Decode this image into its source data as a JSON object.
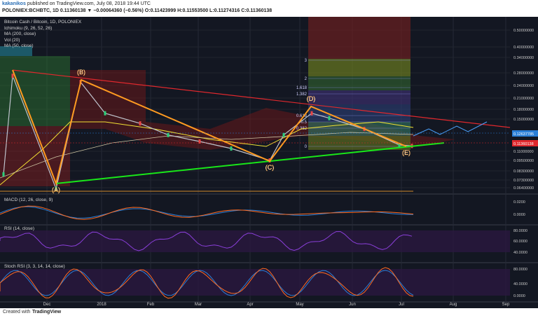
{
  "header": {
    "author": "kakanikos",
    "published": "published on TradingView.com, July 08, 2018 19:44 UTC",
    "symbol_line": "POLONIEX:BCHBTC, 1D 0.11360138 ▼ −0.00064360 (−0.56%) O:0.11423999 H:0.11553500 L:0.11274316 C:0.11360138"
  },
  "legend": {
    "title": "Bitcoin Cash / Bitcoin, 1D, POLONIEX",
    "items": [
      "Ichimoku (9, 26, 52, 26)",
      "MA (200, close)",
      "Vol (20)",
      "MA (50, close)"
    ]
  },
  "footer": {
    "created_with": "Created with",
    "logo": "TradingView"
  },
  "colors": {
    "background": "#131722",
    "pattern": "#ff9b21",
    "support": "#19e619",
    "resistance": "#e0282d",
    "ma_yellow": "#f2e033",
    "macd": "#2a7fd8",
    "signal": "#ff6a1f",
    "rsi": "#8a3fd9"
  },
  "chart_data": [
    {
      "type": "line",
      "title": "Bitcoin Cash / Bitcoin, 1D, POLONIEX",
      "xlabel": "",
      "ylabel": "",
      "x_ticks": [
        "Dec",
        "2018",
        "Feb",
        "Mar",
        "Apr",
        "May",
        "Jun",
        "Jul",
        "Aug",
        "Sep"
      ],
      "y_ticks": [
        "0.60000000",
        "0.50000000",
        "0.40000000",
        "0.34000000",
        "0.28000000",
        "0.24000000",
        "0.21000000",
        "0.18000000",
        "0.15000000",
        "0.12637785",
        "0.11360138",
        "0.11000000",
        "0.09500000",
        "0.08300000",
        "0.07300000",
        "0.06400000"
      ],
      "y_scale": "log",
      "series": [
        {
          "name": "Bitcoin Cash / Bitcoin",
          "x": [
            "Nov",
            "Nov",
            "Dec",
            "Dec",
            "2018",
            "2018",
            "Feb",
            "Mar",
            "Mar",
            "Apr",
            "Apr",
            "May",
            "May",
            "Jun",
            "Jul",
            "Jul"
          ],
          "values": [
            0.08,
            0.27,
            0.067,
            0.25,
            0.17,
            0.15,
            0.13,
            0.12,
            0.11,
            0.095,
            0.13,
            0.17,
            0.16,
            0.14,
            0.115,
            0.1136
          ]
        }
      ],
      "pattern_points": [
        {
          "label": "(A)",
          "value": 0.067
        },
        {
          "label": "(B)",
          "value": 0.25
        },
        {
          "label": "(C)",
          "value": 0.093
        },
        {
          "label": "(D)",
          "value": 0.175
        },
        {
          "label": "(E)",
          "value": 0.112
        }
      ],
      "fib_levels": [
        "3",
        "2",
        "1.618",
        "1.382",
        "0.618",
        "0.5",
        "0.382",
        "0"
      ],
      "price_labels": {
        "resistance": "0.12637785",
        "last": "0.11360138"
      }
    },
    {
      "type": "line",
      "title": "MACD (12, 26, close, 9)",
      "y_ticks": [
        "0.0200",
        "0.0000"
      ]
    },
    {
      "type": "line",
      "title": "RSI (14, close)",
      "y_ticks": [
        "80.0000",
        "60.0000",
        "40.0000"
      ]
    },
    {
      "type": "line",
      "title": "Stoch RSI (3, 3, 14, 14, close)",
      "y_ticks": [
        "80.0000",
        "40.0000",
        "0.0000"
      ]
    }
  ]
}
